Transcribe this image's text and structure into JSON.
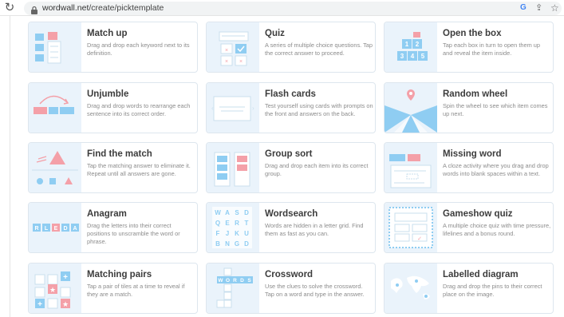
{
  "browser": {
    "url_domain": "wordwall.net",
    "url_path": "/create/picktemplate",
    "google_icon_text": "G"
  },
  "templates": [
    {
      "title": "Match up",
      "desc": "Drag and drop each keyword next to its definition."
    },
    {
      "title": "Quiz",
      "desc": "A series of multiple choice questions. Tap the correct answer to proceed."
    },
    {
      "title": "Open the box",
      "desc": "Tap each box in turn to open them up and reveal the item inside.",
      "numbers": [
        "1",
        "2",
        "3",
        "4",
        "5"
      ]
    },
    {
      "title": "Unjumble",
      "desc": "Drag and drop words to rearrange each sentence into its correct order."
    },
    {
      "title": "Flash cards",
      "desc": "Test yourself using cards with prompts on the front and answers on the back."
    },
    {
      "title": "Random wheel",
      "desc": "Spin the wheel to see which item comes up next."
    },
    {
      "title": "Find the match",
      "desc": "Tap the matching answer to eliminate it. Repeat until all answers are gone."
    },
    {
      "title": "Group sort",
      "desc": "Drag and drop each item into its correct group."
    },
    {
      "title": "Missing word",
      "desc": "A cloze activity where you drag and drop words into blank spaces within a text."
    },
    {
      "title": "Anagram",
      "desc": "Drag the letters into their correct positions to unscramble the word or phrase.",
      "letters": [
        "R",
        "L",
        "E",
        "D",
        "A"
      ]
    },
    {
      "title": "Wordsearch",
      "desc": "Words are hidden in a letter grid. Find them as fast as you can.",
      "letters": [
        "W",
        "A",
        "S",
        "D",
        "Q",
        "E",
        "R",
        "T",
        "F",
        "J",
        "K",
        "U",
        "B",
        "N",
        "G",
        "D"
      ]
    },
    {
      "title": "Gameshow quiz",
      "desc": "A multiple choice quiz with time pressure, lifelines and a bonus round."
    },
    {
      "title": "Matching pairs",
      "desc": "Tap a pair of tiles at a time to reveal if they are a match."
    },
    {
      "title": "Crossword",
      "desc": "Use the clues to solve the crossword. Tap on a word and type in the answer.",
      "letters": [
        "W",
        "O",
        "R",
        "D",
        "S"
      ]
    },
    {
      "title": "Labelled diagram",
      "desc": "Drag and drop the pins to their correct place on the image."
    }
  ],
  "colors": {
    "accent_red": "#f4a0a8",
    "accent_blue": "#8fcdf2",
    "thumb_bg": "#eaf3fb"
  }
}
